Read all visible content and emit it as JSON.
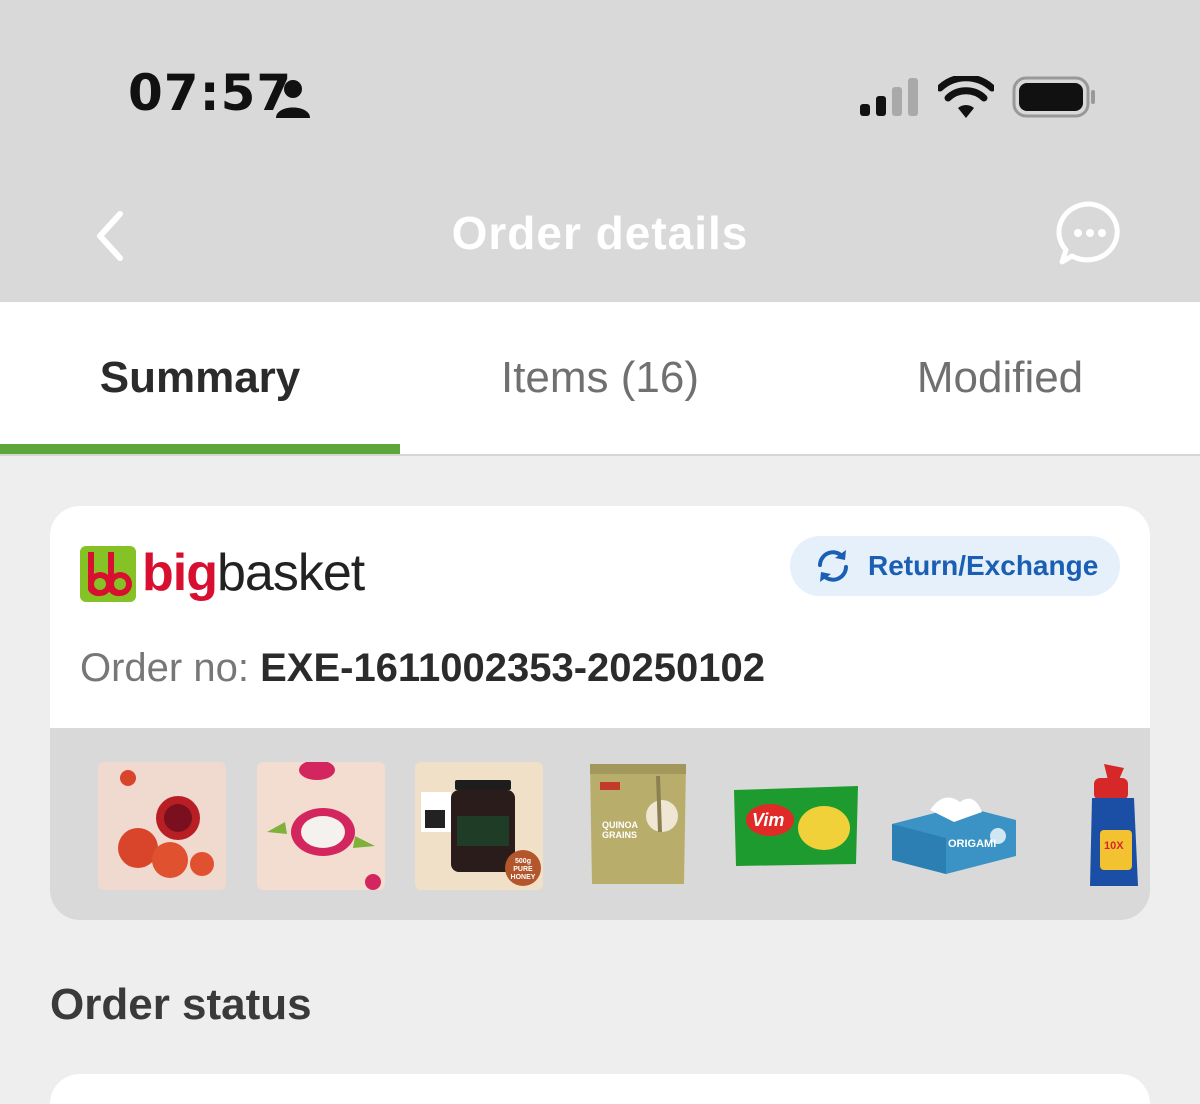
{
  "status_bar": {
    "time": "07:57",
    "icons": [
      "person-icon",
      "signal-icon",
      "wifi-icon",
      "battery-icon"
    ]
  },
  "header": {
    "title": "Order details",
    "back_icon": "chevron-left-icon",
    "chat_icon": "chat-bubble-icon"
  },
  "tabs": [
    {
      "label": "Summary",
      "active": true
    },
    {
      "label": "Items (16)",
      "active": false
    },
    {
      "label": "Modified",
      "active": false
    }
  ],
  "order": {
    "brand_big": "big",
    "brand_basket": "basket",
    "return_label": "Return/Exchange",
    "order_no_label": "Order no: ",
    "order_no_value": "EXE-1611002353-20250102",
    "thumbnails": [
      {
        "name": "pomegranate-thumbnail"
      },
      {
        "name": "dragon-fruit-thumbnail"
      },
      {
        "name": "honey-jar-thumbnail",
        "badge": "500g PURE HONEY"
      },
      {
        "name": "quinoa-pack-thumbnail",
        "text": "QUINOA GRAINS"
      },
      {
        "name": "vim-bar-thumbnail",
        "text": "Vim"
      },
      {
        "name": "origami-tissue-thumbnail",
        "text": "ORIGAMI"
      },
      {
        "name": "harpic-bottle-thumbnail",
        "text": "10X"
      }
    ]
  },
  "sections": {
    "order_status_title": "Order status"
  },
  "colors": {
    "accent_green": "#5ea53a",
    "brand_red": "#d80f31",
    "brand_green": "#84c225",
    "link_blue": "#1a5fb4"
  }
}
